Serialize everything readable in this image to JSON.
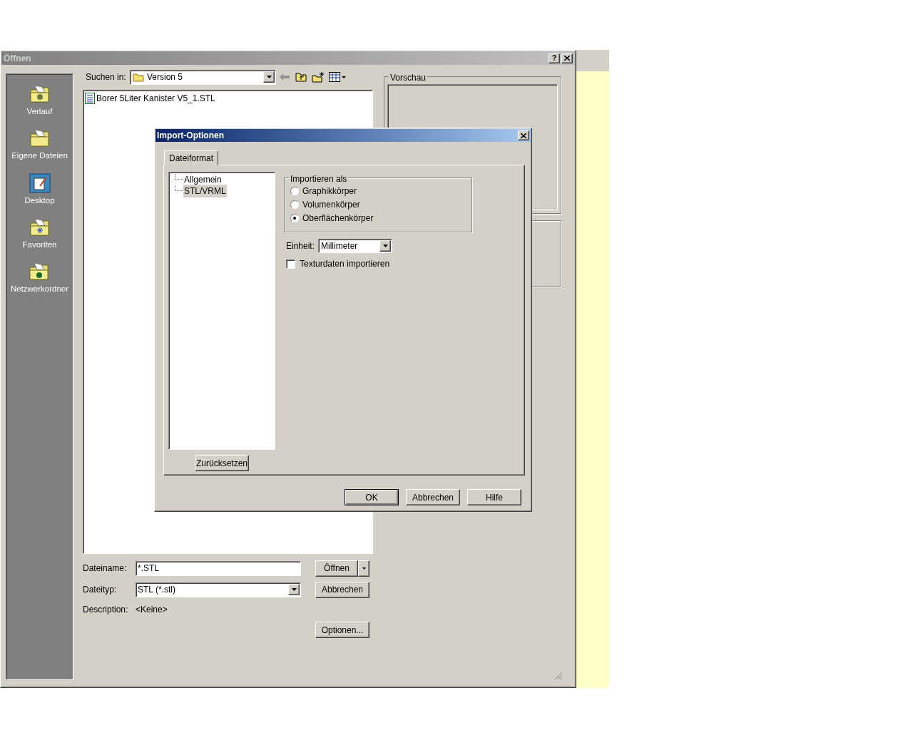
{
  "open_dialog": {
    "title": "Öffnen",
    "help_button": "?",
    "places": [
      {
        "label": "Verlauf",
        "kind": "history"
      },
      {
        "label": "Eigene Dateien",
        "kind": "documents"
      },
      {
        "label": "Desktop",
        "kind": "desktop"
      },
      {
        "label": "Favoriten",
        "kind": "favorites"
      },
      {
        "label": "Netzwerkordner",
        "kind": "network"
      }
    ],
    "look_in": {
      "label": "Suchen in:",
      "value": "Version 5"
    },
    "files": [
      {
        "name": "Borer 5Liter Kanister V5_1.STL"
      }
    ],
    "preview": {
      "label": "Vorschau"
    },
    "file_name": {
      "label": "Dateiname:",
      "value": "*.STL"
    },
    "file_type": {
      "label": "Dateityp:",
      "value": "STL (*.stl)"
    },
    "description": {
      "label": "Description:",
      "value": "<Keine>"
    },
    "open_button": "Öffnen",
    "cancel_button": "Abbrechen",
    "options_button": "Optionen..."
  },
  "import_dialog": {
    "title": "Import-Optionen",
    "tabs": [
      {
        "label": "Dateiformat",
        "selected": true
      }
    ],
    "tree": [
      {
        "label": "Allgemein",
        "selected": false
      },
      {
        "label": "STL/VRML",
        "selected": true
      }
    ],
    "reset_button": "Zurücksetzen",
    "import_as": {
      "label": "Importieren als",
      "options": [
        {
          "label": "Graphikkörper",
          "selected": false
        },
        {
          "label": "Volumenkörper",
          "selected": false
        },
        {
          "label": "Oberflächenkörper",
          "selected": true
        }
      ]
    },
    "unit": {
      "label": "Einheit:",
      "value": "Millimeter"
    },
    "texture": {
      "label": "Texturdaten importieren",
      "checked": false
    },
    "buttons": [
      {
        "label": "OK",
        "default": true
      },
      {
        "label": "Abbrechen",
        "default": false
      },
      {
        "label": "Hilfe",
        "default": false
      }
    ]
  }
}
